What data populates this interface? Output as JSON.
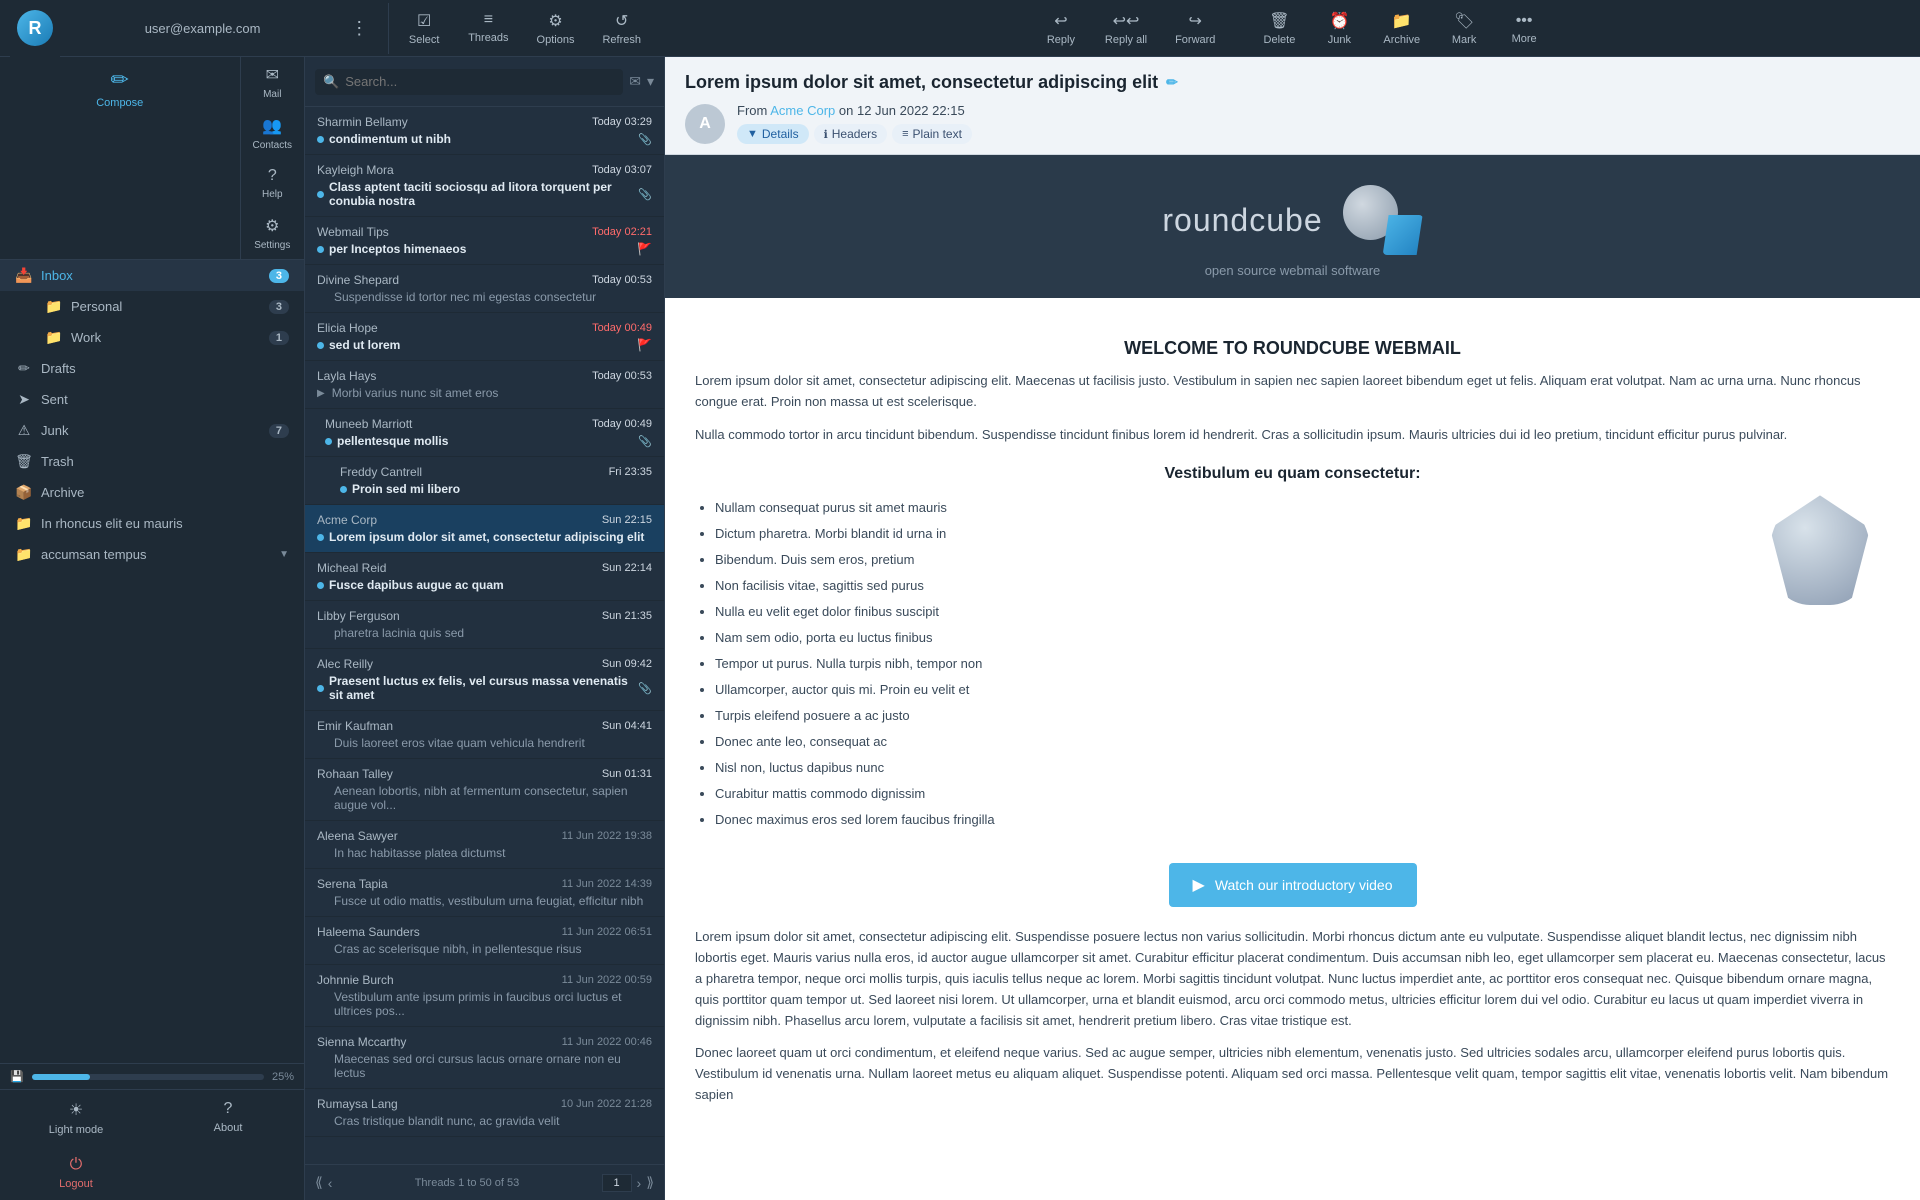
{
  "toolbar": {
    "user_email": "user@example.com",
    "reply_label": "Reply",
    "reply_all_label": "Reply all",
    "forward_label": "Forward",
    "delete_label": "Delete",
    "junk_label": "Junk",
    "archive_label": "Archive",
    "mark_label": "Mark",
    "more_label": "More",
    "select_label": "Select",
    "threads_label": "Threads",
    "options_label": "Options",
    "refresh_label": "Refresh"
  },
  "sidebar": {
    "compose_label": "Compose",
    "mail_label": "Mail",
    "contacts_label": "Contacts",
    "help_label": "Help",
    "settings_label": "Settings",
    "inbox_label": "Inbox",
    "inbox_count": "3",
    "personal_label": "Personal",
    "personal_count": "3",
    "work_label": "Work",
    "work_count": "1",
    "drafts_label": "Drafts",
    "sent_label": "Sent",
    "junk_label": "Junk",
    "junk_count": "7",
    "trash_label": "Trash",
    "archive_label": "Archive",
    "folder1_label": "In rhoncus elit eu mauris",
    "folder2_label": "accumsan tempus",
    "light_mode_label": "Light mode",
    "about_label": "About",
    "logout_label": "Logout",
    "storage_percent": "25%"
  },
  "email_list": {
    "search_placeholder": "Search...",
    "footer_text": "Threads 1 to 50 of 53",
    "page_current": "1",
    "emails": [
      {
        "sender": "Sharmin Bellamy",
        "date": "Today 03:29",
        "date_class": "today",
        "subject": "condimentum ut nibh",
        "unread": true,
        "attachment": true,
        "flag": false,
        "selected": false,
        "indent": 0
      },
      {
        "sender": "Kayleigh Mora",
        "date": "Today 03:07",
        "date_class": "today",
        "subject": "Class aptent taciti sociosqu ad litora torquent per conubia nostra",
        "unread": true,
        "attachment": true,
        "flag": false,
        "selected": false,
        "indent": 0
      },
      {
        "sender": "Webmail Tips",
        "date": "Today 02:21",
        "date_class": "unread-today",
        "subject": "per Inceptos himenaeos",
        "unread": true,
        "attachment": false,
        "flag": true,
        "selected": false,
        "indent": 0
      },
      {
        "sender": "Divine Shepard",
        "date": "Today 00:53",
        "date_class": "today",
        "subject": "Suspendisse id tortor nec mi egestas consectetur",
        "unread": false,
        "attachment": false,
        "flag": false,
        "selected": false,
        "indent": 0
      },
      {
        "sender": "Elicia Hope",
        "date": "Today 00:49",
        "date_class": "unread-today",
        "subject": "sed ut lorem",
        "unread": true,
        "attachment": false,
        "flag": true,
        "selected": false,
        "indent": 0
      },
      {
        "sender": "Layla Hays",
        "date": "Today 00:53",
        "date_class": "today",
        "subject": "Morbi varius nunc sit amet eros",
        "unread": false,
        "attachment": false,
        "flag": false,
        "selected": false,
        "indent": 0,
        "is_thread": true
      },
      {
        "sender": "Muneeb Marriott",
        "date": "Today 00:49",
        "date_class": "today",
        "subject": "pellentesque mollis",
        "unread": true,
        "attachment": true,
        "flag": false,
        "selected": false,
        "indent": 1
      },
      {
        "sender": "Freddy Cantrell",
        "date": "Fri 23:35",
        "date_class": "today",
        "subject": "Proin sed mi libero",
        "unread": true,
        "attachment": false,
        "flag": false,
        "selected": false,
        "indent": 2
      },
      {
        "sender": "Acme Corp",
        "date": "Sun 22:15",
        "date_class": "today",
        "subject": "Lorem ipsum dolor sit amet, consectetur adipiscing elit",
        "unread": true,
        "attachment": false,
        "flag": false,
        "selected": true,
        "indent": 0
      },
      {
        "sender": "Micheal Reid",
        "date": "Sun 22:14",
        "date_class": "today",
        "subject": "Fusce dapibus augue ac quam",
        "unread": true,
        "attachment": false,
        "flag": false,
        "selected": false,
        "indent": 0
      },
      {
        "sender": "Libby Ferguson",
        "date": "Sun 21:35",
        "date_class": "today",
        "subject": "pharetra lacinia quis sed",
        "unread": false,
        "attachment": false,
        "flag": false,
        "selected": false,
        "indent": 0
      },
      {
        "sender": "Alec Reilly",
        "date": "Sun 09:42",
        "date_class": "today",
        "subject": "Praesent luctus ex felis, vel cursus massa venenatis sit amet",
        "unread": true,
        "attachment": true,
        "flag": false,
        "selected": false,
        "indent": 0
      },
      {
        "sender": "Emir Kaufman",
        "date": "Sun 04:41",
        "date_class": "today",
        "subject": "Duis laoreet eros vitae quam vehicula hendrerit",
        "unread": false,
        "attachment": false,
        "flag": false,
        "selected": false,
        "indent": 0
      },
      {
        "sender": "Rohaan Talley",
        "date": "Sun 01:31",
        "date_class": "today",
        "subject": "Aenean lobortis, nibh at fermentum consectetur, sapien augue vol...",
        "unread": false,
        "attachment": false,
        "flag": false,
        "selected": false,
        "indent": 0
      },
      {
        "sender": "Aleena Sawyer",
        "date": "11 Jun 2022 19:38",
        "date_class": "",
        "subject": "In hac habitasse platea dictumst",
        "unread": false,
        "attachment": false,
        "flag": false,
        "selected": false,
        "indent": 0
      },
      {
        "sender": "Serena Tapia",
        "date": "11 Jun 2022 14:39",
        "date_class": "",
        "subject": "Fusce ut odio mattis, vestibulum urna feugiat, efficitur nibh",
        "unread": false,
        "attachment": false,
        "flag": false,
        "selected": false,
        "indent": 0
      },
      {
        "sender": "Haleema Saunders",
        "date": "11 Jun 2022 06:51",
        "date_class": "",
        "subject": "Cras ac scelerisque nibh, in pellentesque risus",
        "unread": false,
        "attachment": false,
        "flag": false,
        "selected": false,
        "indent": 0
      },
      {
        "sender": "Johnnie Burch",
        "date": "11 Jun 2022 00:59",
        "date_class": "",
        "subject": "Vestibulum ante ipsum primis in faucibus orci luctus et ultrices pos...",
        "unread": false,
        "attachment": false,
        "flag": false,
        "selected": false,
        "indent": 0
      },
      {
        "sender": "Sienna Mccarthy",
        "date": "11 Jun 2022 00:46",
        "date_class": "",
        "subject": "Maecenas sed orci cursus lacus ornare ornare non eu lectus",
        "unread": false,
        "attachment": false,
        "flag": false,
        "selected": false,
        "indent": 0
      },
      {
        "sender": "Rumaysa Lang",
        "date": "10 Jun 2022 21:28",
        "date_class": "",
        "subject": "Cras tristique blandit nunc, ac gravida velit",
        "unread": false,
        "attachment": false,
        "flag": false,
        "selected": false,
        "indent": 0
      }
    ]
  },
  "email_view": {
    "subject": "Lorem ipsum dolor sit amet, consectetur adipiscing elit",
    "from_label": "From",
    "from_name": "Acme Corp",
    "from_date": "on 12 Jun 2022 22:15",
    "details_tab": "Details",
    "headers_tab": "Headers",
    "plain_tab": "Plain text",
    "welcome_title": "WELCOME TO ROUNDCUBE WEBMAIL",
    "logo_text": "roundcube",
    "logo_tagline": "open source webmail software",
    "intro1": "Lorem ipsum dolor sit amet, consectetur adipiscing elit. Maecenas ut facilisis justo. Vestibulum in sapien nec sapien laoreet bibendum eget ut felis. Aliquam erat volutpat. Nam ac urna urna. Nunc rhoncus congue erat. Proin non massa ut est scelerisque.",
    "intro2": "Nulla commodo tortor in arcu tincidunt bibendum. Suspendisse tincidunt finibus lorem id hendrerit. Cras a sollicitudin ipsum. Mauris ultricies dui id leo pretium, tincidunt efficitur purus pulvinar.",
    "vestibulum_title": "Vestibulum eu quam consectetur:",
    "features": [
      "Nullam consequat purus sit amet mauris",
      "Dictum pharetra. Morbi blandit id urna in",
      "Bibendum. Duis sem eros, pretium",
      "Non facilisis vitae, sagittis sed purus",
      "Nulla eu velit eget dolor finibus suscipit",
      "Nam sem odio, porta eu luctus finibus",
      "Tempor ut purus. Nulla turpis nibh, tempor non",
      "Ullamcorper, auctor quis mi. Proin eu velit et",
      "Turpis eleifend posuere a ac justo",
      "Donec ante leo, consequat ac",
      "Nisl non, luctus dapibus nunc",
      "Curabitur mattis commodo dignissim",
      "Donec maximus eros sed lorem faucibus fringilla"
    ],
    "video_btn": "Watch our introductory video",
    "body1": "Lorem ipsum dolor sit amet, consectetur adipiscing elit. Suspendisse posuere lectus non varius sollicitudin. Morbi rhoncus dictum ante eu vulputate. Suspendisse aliquet blandit lectus, nec dignissim nibh lobortis eget. Mauris varius nulla eros, id auctor augue ullamcorper sit amet. Curabitur efficitur placerat condimentum. Duis accumsan nibh leo, eget ullamcorper sem placerat eu. Maecenas consectetur, lacus a pharetra tempor, neque orci mollis turpis, quis iaculis tellus neque ac lorem. Morbi sagittis tincidunt volutpat. Nunc luctus imperdiet ante, ac porttitor eros consequat nec. Quisque bibendum ornare magna, quis porttitor quam tempor ut. Sed laoreet nisi lorem. Ut ullamcorper, urna et blandit euismod, arcu orci commodo metus, ultricies efficitur lorem dui vel odio. Curabitur eu lacus ut quam imperdiet viverra in dignissim nibh. Phasellus arcu lorem, vulputate a facilisis sit amet, hendrerit pretium libero. Cras vitae tristique est.",
    "body2": "Donec laoreet quam ut orci condimentum, et eleifend neque varius. Sed ac augue semper, ultricies nibh elementum, venenatis justo. Sed ultricies sodales arcu, ullamcorper eleifend purus lobortis quis. Vestibulum id venenatis urna. Nullam laoreet metus eu aliquam aliquet. Suspendisse potenti. Aliquam sed orci massa. Pellentesque velit quam, tempor sagittis elit vitae, venenatis lobortis velit. Nam bibendum sapien"
  }
}
